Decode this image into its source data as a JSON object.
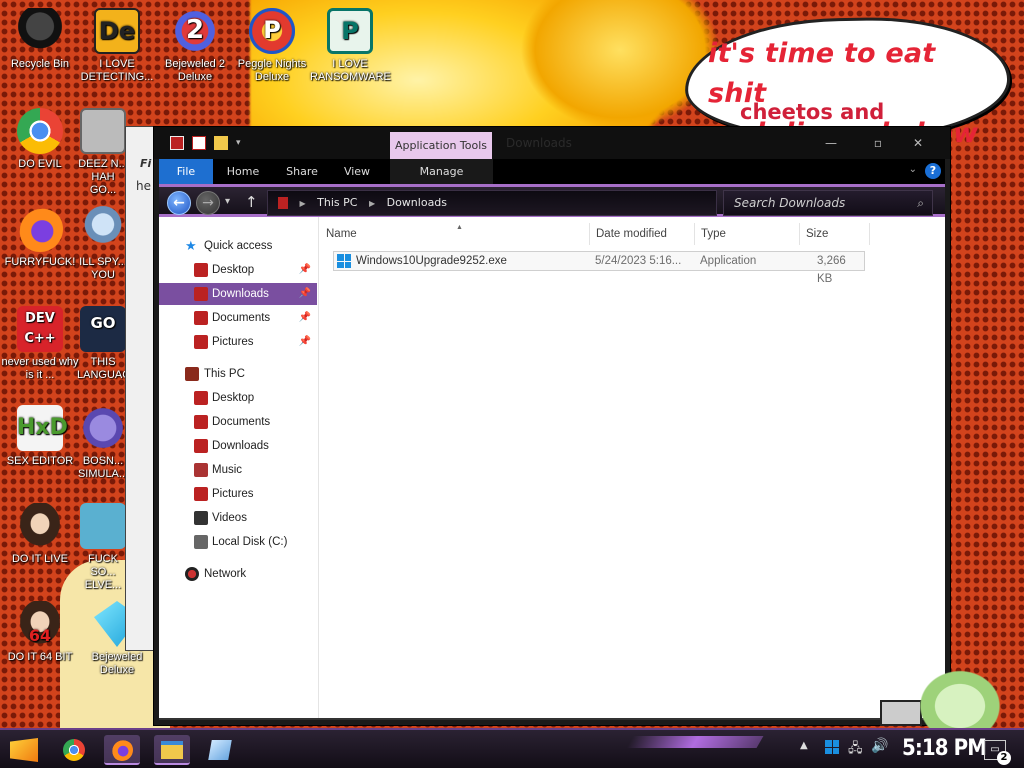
{
  "wallpaper": {
    "speech_bubble": {
      "line1": "it's time to eat shit",
      "line2": "and die and chew",
      "line3": "cheetos and"
    }
  },
  "desktop_icons": [
    {
      "label": "Recycle Bin",
      "icon": "recycle-bin-icon"
    },
    {
      "label": "I LOVE DETECTING...",
      "icon": "detect-it-easy-icon"
    },
    {
      "label": "Bejeweled 2 Deluxe",
      "icon": "bejeweled-2-icon"
    },
    {
      "label": "Peggle Nights Deluxe",
      "icon": "peggle-icon"
    },
    {
      "label": "I LOVE RANSOMWARE",
      "icon": "publisher-icon"
    },
    {
      "label": "DO EVIL",
      "icon": "chrome-icon"
    },
    {
      "label": "DEEZ N... HAH GO...",
      "icon": "files-icon"
    },
    {
      "label": "FURRYFUCK!",
      "icon": "firefox-icon"
    },
    {
      "label": "ILL SPY... YOU",
      "icon": "spy-icon"
    },
    {
      "label": "never used why is it ...",
      "icon": "devcpp-icon"
    },
    {
      "label": "THIS LANGUAG...",
      "icon": "golang-icon"
    },
    {
      "label": "SEX EDITOR",
      "icon": "hxd-icon"
    },
    {
      "label": "BOSN... SIMULA...",
      "icon": "virus-icon"
    },
    {
      "label": "DO IT LIVE",
      "icon": "portrait-icon"
    },
    {
      "label": "FUCK SO... ELVE...",
      "icon": "elf-icon"
    },
    {
      "label": "DO IT 64 BIT",
      "icon": "portrait-64-icon"
    },
    {
      "label": "Bejeweled Deluxe",
      "icon": "bejeweled-icon"
    }
  ],
  "behind_window": {
    "label1": "Fi",
    "label2": "he"
  },
  "explorer": {
    "title": "Downloads",
    "contextual_tab_group": "Application Tools",
    "window_controls": {
      "minimize": "—",
      "maximize": "▫",
      "close": "✕"
    },
    "ribbon_tabs": [
      "File",
      "Home",
      "Share",
      "View",
      "Manage"
    ],
    "help": "?",
    "address": {
      "parts": [
        "This PC",
        "Downloads"
      ]
    },
    "search": {
      "placeholder": "Search Downloads"
    },
    "nav": {
      "quick_access": "Quick access",
      "quick_items": [
        "Desktop",
        "Downloads",
        "Documents",
        "Pictures"
      ],
      "this_pc": "This PC",
      "pc_items": [
        "Desktop",
        "Documents",
        "Downloads",
        "Music",
        "Pictures",
        "Videos",
        "Local Disk (C:)"
      ],
      "network": "Network",
      "selected": "Downloads"
    },
    "columns": [
      "Name",
      "Date modified",
      "Type",
      "Size"
    ],
    "files": [
      {
        "name": "Windows10Upgrade9252.exe",
        "date": "5/24/2023 5:16...",
        "type": "Application",
        "size": "3,266 KB"
      }
    ]
  },
  "taskbar": {
    "pinned": [
      "start-icon",
      "chrome-icon",
      "firefox-icon",
      "file-explorer-icon",
      "notepad-icon"
    ],
    "clock": "5:18 PM",
    "notifications": "2"
  },
  "colors": {
    "accent": "#7a4fa0",
    "file_tab": "#1e6fd0",
    "bubble_text": "#e52436"
  }
}
